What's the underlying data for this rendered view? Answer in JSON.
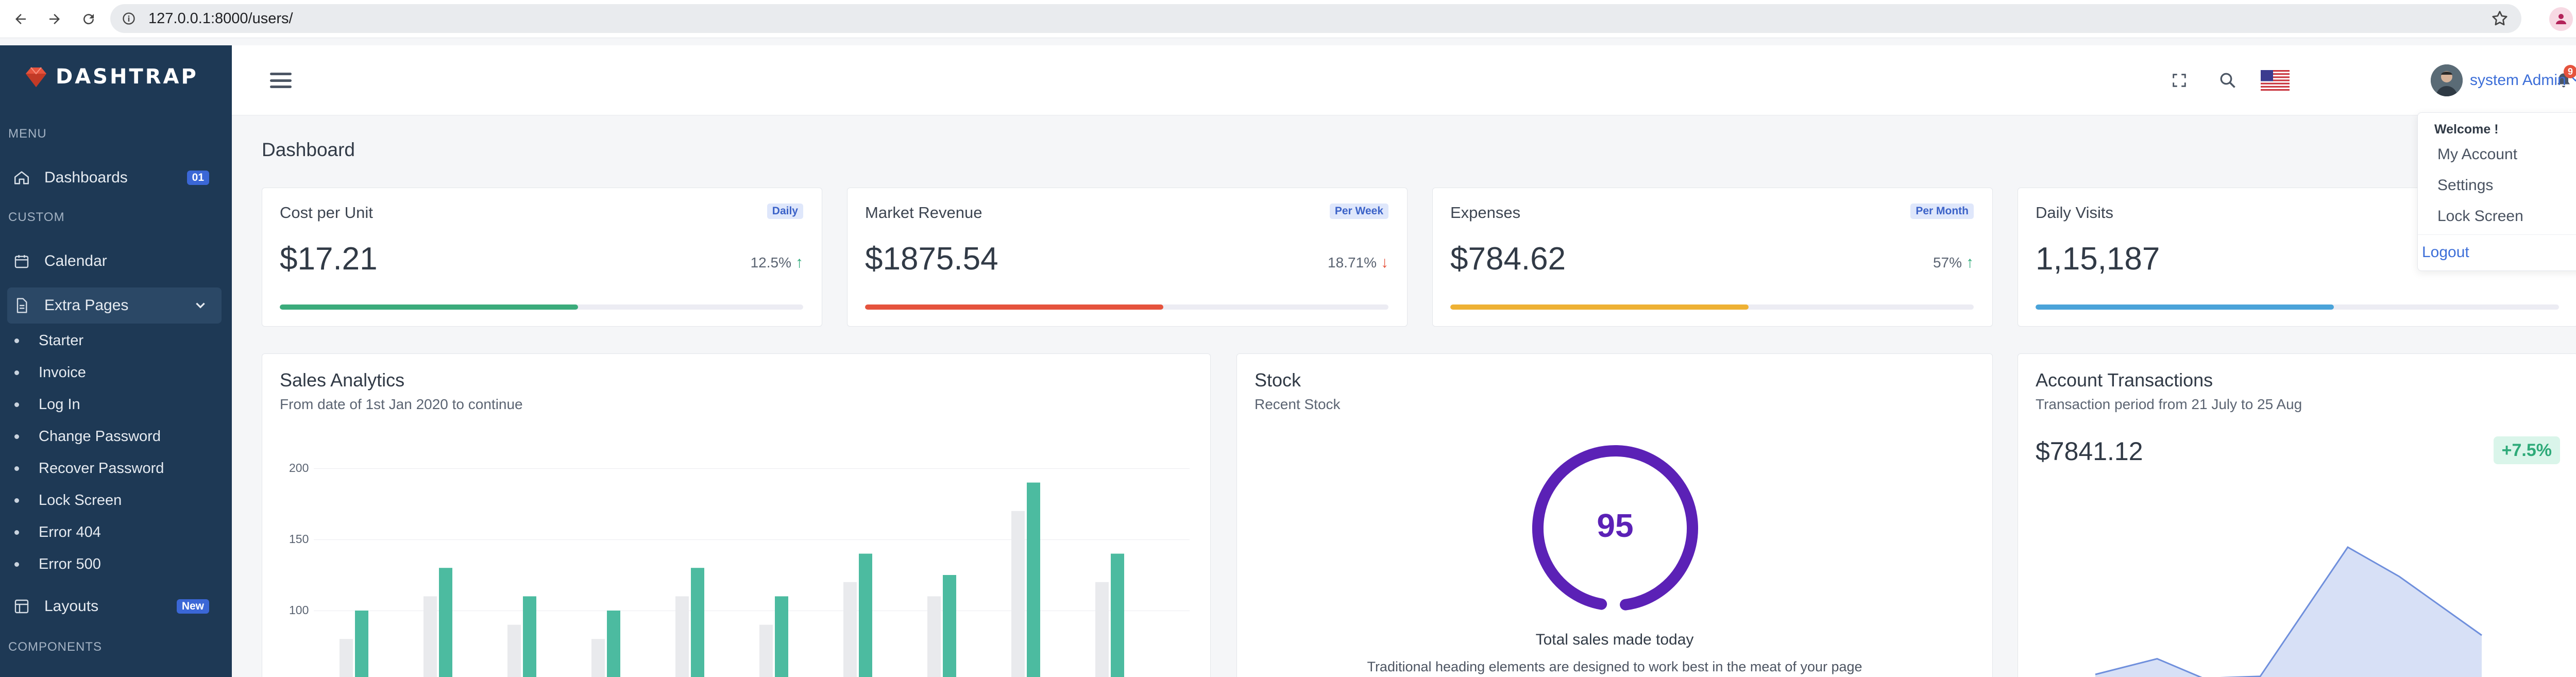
{
  "browser": {
    "url": "127.0.0.1:8000/users/"
  },
  "sidebar": {
    "brand": "DASHTRAP",
    "sections": {
      "menu": "MENU",
      "custom": "CUSTOM",
      "components": "COMPONENTS"
    },
    "items": [
      {
        "label": "Dashboards",
        "badge": "01"
      },
      {
        "label": "Calendar"
      },
      {
        "label": "Extra Pages"
      },
      {
        "label": "Layouts",
        "badge": "New"
      }
    ],
    "sub_items": [
      "Starter",
      "Invoice",
      "Log In",
      "Change Password",
      "Recover Password",
      "Lock Screen",
      "Error 404",
      "Error 500"
    ]
  },
  "topbar": {
    "notification_count": "9",
    "user_name": "system Admin"
  },
  "page": {
    "title": "Dashboard"
  },
  "stats": [
    {
      "label": "Cost per Unit",
      "tag": "Daily",
      "value": "$17.21",
      "change": "12.5%",
      "direction": "up",
      "progress": 0.57,
      "color": "#3bab7b"
    },
    {
      "label": "Market Revenue",
      "tag": "Per Week",
      "value": "$1875.54",
      "change": "18.71%",
      "direction": "down",
      "progress": 0.57,
      "color": "#e5533d"
    },
    {
      "label": "Expenses",
      "tag": "Per Month",
      "value": "$784.62",
      "change": "57%",
      "direction": "up",
      "progress": 0.57,
      "color": "#eeb134"
    },
    {
      "label": "Daily Visits",
      "tag": "",
      "value": "1,15,187",
      "change": "",
      "direction": "",
      "progress": 0.57,
      "color": "#4aa3d9"
    }
  ],
  "sales": {
    "title": "Sales Analytics",
    "subtitle": "From date of 1st Jan 2020 to continue"
  },
  "chart_data": {
    "type": "bar",
    "categories": [
      "",
      "",
      "",
      "",
      "",
      "",
      "",
      "",
      "",
      ""
    ],
    "series": [
      {
        "values": [
          80,
          110,
          90,
          80,
          110,
          90,
          120,
          110,
          170,
          120
        ]
      },
      {
        "values": [
          100,
          130,
          110,
          100,
          130,
          110,
          140,
          125,
          190,
          140
        ]
      }
    ],
    "yticks": [
      "200",
      "150",
      "100"
    ],
    "ylim": [
      50,
      210
    ],
    "colors": [
      "#e9eaed",
      "#4cbba0"
    ]
  },
  "stock": {
    "title": "Stock",
    "subtitle": "Recent Stock",
    "gauge_value": "95",
    "gauge_fraction": 0.95,
    "caption": "Total sales made today",
    "description": "Traditional heading elements are designed to work best in the meat of your page"
  },
  "transactions": {
    "title": "Account Transactions",
    "subtitle": "Transaction period from 21 July to 25 Aug",
    "amount": "$7841.12",
    "change": "+7.5%",
    "area_values": [
      20,
      36,
      16,
      18,
      150,
      120,
      60
    ]
  },
  "dropdown": {
    "welcome": "Welcome !",
    "items": [
      "My Account",
      "Settings",
      "Lock Screen"
    ],
    "logout": "Logout"
  }
}
